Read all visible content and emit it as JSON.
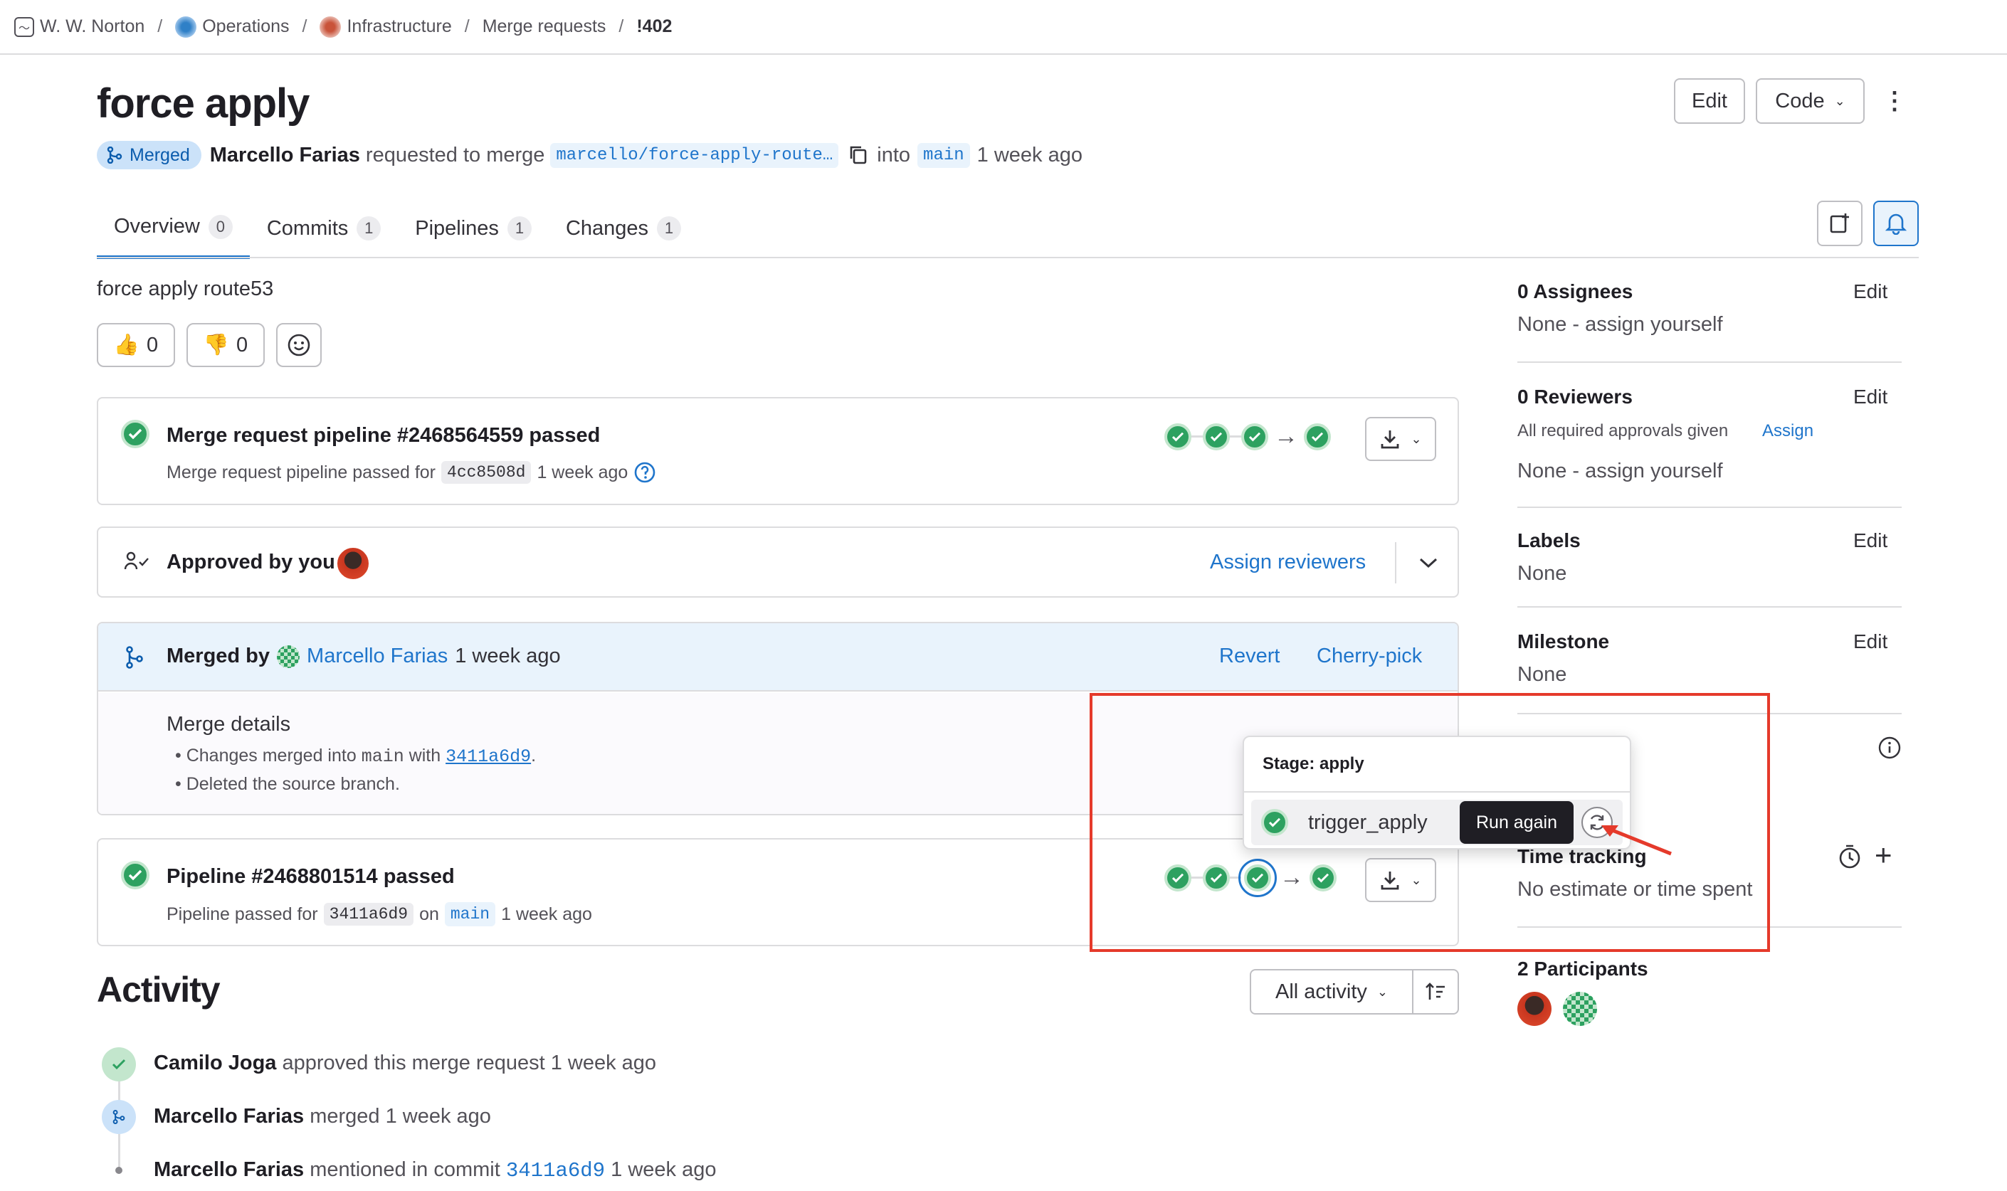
{
  "breadcrumb": {
    "items": [
      "W. W. Norton",
      "Operations",
      "Infrastructure",
      "Merge requests",
      "!402"
    ]
  },
  "header": {
    "title": "force apply",
    "edit_label": "Edit",
    "code_label": "Code",
    "more_label": "⋮"
  },
  "meta": {
    "status": "Merged",
    "author": "Marcello Farias",
    "action": "requested to merge",
    "source_branch": "marcello/force-apply-route…",
    "into": "into",
    "target_branch": "main",
    "time": "1 week ago"
  },
  "tabs": [
    {
      "label": "Overview",
      "count": "0"
    },
    {
      "label": "Commits",
      "count": "1"
    },
    {
      "label": "Pipelines",
      "count": "1"
    },
    {
      "label": "Changes",
      "count": "1"
    }
  ],
  "description": "force apply route53",
  "reactions": {
    "thumbs_up": "👍",
    "thumbs_up_count": "0",
    "thumbs_down": "👎",
    "thumbs_down_count": "0"
  },
  "mr_pipeline": {
    "prefix": "Merge request pipeline",
    "id": "#2468564559",
    "status": "passed",
    "detail_prefix": "Merge request pipeline passed for",
    "sha": "4cc8508d",
    "time": "1 week ago"
  },
  "approval": {
    "text": "Approved by you",
    "assign_label": "Assign reviewers"
  },
  "merged": {
    "prefix": "Merged by",
    "user": "Marcello Farias",
    "time": "1 week ago",
    "revert_label": "Revert",
    "cherry_label": "Cherry-pick",
    "details_title": "Merge details",
    "detail1_prefix": "Changes merged into",
    "detail1_branch": "main",
    "detail1_with": "with",
    "detail1_sha": "3411a6d9",
    "detail1_end": ".",
    "detail2": "Deleted the source branch."
  },
  "pipeline": {
    "prefix": "Pipeline",
    "id": "#2468801514",
    "status": "passed",
    "detail_prefix": "Pipeline passed for",
    "sha": "3411a6d9",
    "on": "on",
    "branch": "main",
    "time": "1 week ago"
  },
  "popover": {
    "title": "Stage: apply",
    "job": "trigger_apply",
    "tooltip": "Run again"
  },
  "activity": {
    "title": "Activity",
    "filter_label": "All activity",
    "items": [
      {
        "user": "Camilo Joga",
        "text": "approved this merge request 1 week ago"
      },
      {
        "user": "Marcello Farias",
        "text": "merged 1 week ago"
      },
      {
        "user": "Marcello Farias",
        "text": "mentioned in commit",
        "sha": "3411a6d9",
        "time": "1 week ago"
      }
    ]
  },
  "sidebar": {
    "assignees_title": "0 Assignees",
    "assignees_value": "None - assign yourself",
    "reviewers_title": "0 Reviewers",
    "reviewers_approvals": "All required approvals given",
    "reviewers_assign": "Assign",
    "reviewers_value": "None - assign yourself",
    "labels_title": "Labels",
    "labels_value": "None",
    "milestone_title": "Milestone",
    "milestone_value": "None",
    "time_title": "Time tracking",
    "time_value": "No estimate or time spent",
    "participants_title": "2 Participants",
    "edit_label": "Edit"
  },
  "colors": {
    "accent": "#1f75cb",
    "success": "#2da160",
    "highlight": "#e53a2b"
  }
}
